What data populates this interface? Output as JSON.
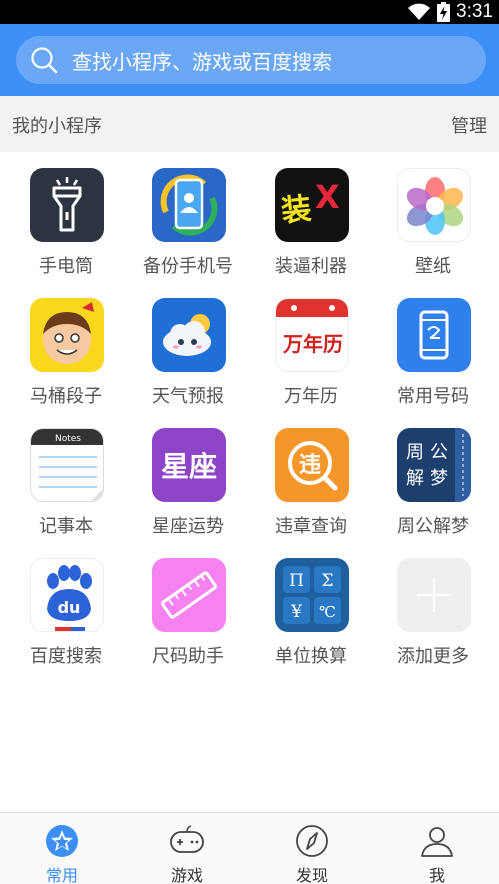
{
  "status_bar": {
    "time": "3:31",
    "icons": [
      "wifi-icon",
      "battery-charging-icon"
    ]
  },
  "search": {
    "placeholder": "查找小程序、游戏或百度搜索"
  },
  "section": {
    "title": "我的小程序",
    "manage_label": "管理"
  },
  "apps": [
    {
      "label": "手电筒",
      "icon": "flashlight-icon"
    },
    {
      "label": "备份手机号",
      "icon": "phone-backup-icon"
    },
    {
      "label": "装逼利器",
      "icon": "zhuangx-icon",
      "icon_text": "装",
      "icon_text2": "X"
    },
    {
      "label": "壁纸",
      "icon": "wallpaper-icon"
    },
    {
      "label": "马桶段子",
      "icon": "cartoon-face-icon"
    },
    {
      "label": "天气预报",
      "icon": "weather-icon"
    },
    {
      "label": "万年历",
      "icon": "calendar-icon",
      "icon_text": "万年历"
    },
    {
      "label": "常用号码",
      "icon": "phone-numbers-icon"
    },
    {
      "label": "记事本",
      "icon": "notepad-icon",
      "icon_text": "Notes"
    },
    {
      "label": "星座运势",
      "icon": "horoscope-icon",
      "icon_text": "星座"
    },
    {
      "label": "违章查询",
      "icon": "traffic-violation-icon",
      "icon_text": "违"
    },
    {
      "label": "周公解梦",
      "icon": "dream-book-icon",
      "icon_text": [
        "周",
        "公",
        "解",
        "梦"
      ]
    },
    {
      "label": "百度搜索",
      "icon": "baidu-icon",
      "icon_text": "du"
    },
    {
      "label": "尺码助手",
      "icon": "ruler-icon"
    },
    {
      "label": "单位换算",
      "icon": "unit-converter-icon",
      "icon_text": [
        "Π",
        "Σ",
        "¥",
        "℃"
      ]
    },
    {
      "label": "添加更多",
      "icon": "add-more-icon"
    }
  ],
  "tabs": [
    {
      "label": "常用",
      "icon": "star-icon",
      "active": true
    },
    {
      "label": "游戏",
      "icon": "gamepad-icon",
      "active": false
    },
    {
      "label": "发现",
      "icon": "compass-icon",
      "active": false
    },
    {
      "label": "我",
      "icon": "user-icon",
      "active": false
    }
  ],
  "colors": {
    "header_blue": "#3d8ef5",
    "search_box": "#6aa8f7",
    "tab_active": "#3d8ef5"
  }
}
